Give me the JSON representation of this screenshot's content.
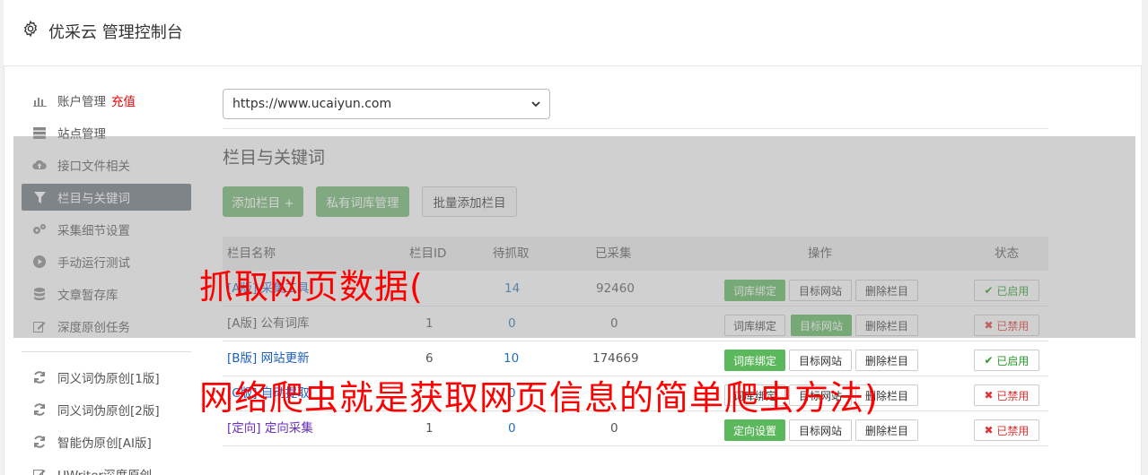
{
  "header": {
    "title": "优采云 管理控制台"
  },
  "sidebar": {
    "items": [
      {
        "label": "账户管理",
        "extra": "充值",
        "icon": "bar-chart-icon"
      },
      {
        "label": "站点管理",
        "icon": "server-icon"
      },
      {
        "label": "接口文件相关",
        "icon": "cloud-upload-icon"
      },
      {
        "label": "栏目与关键词",
        "icon": "filter-icon",
        "active": true
      },
      {
        "label": "采集细节设置",
        "icon": "cogs-icon"
      },
      {
        "label": "手动运行测试",
        "icon": "play-circle-icon"
      },
      {
        "label": "文章暂存库",
        "icon": "database-icon"
      },
      {
        "label": "深度原创任务",
        "icon": "edit-icon"
      }
    ],
    "items2": [
      {
        "label": "同义词伪原创[1版]",
        "icon": "refresh-icon"
      },
      {
        "label": "同义词伪原创[2版]",
        "icon": "refresh-icon"
      },
      {
        "label": "智能伪原创[AI版]",
        "icon": "refresh-icon"
      },
      {
        "label": "UWriter深度原创",
        "icon": "edit-icon"
      }
    ]
  },
  "site_select": {
    "value": "https://www.ucaiyun.com"
  },
  "main": {
    "section_title": "栏目与关键词",
    "buttons": {
      "add": "添加栏目 +",
      "private_lib": "私有词库管理",
      "batch_add": "批量添加栏目"
    }
  },
  "table": {
    "headers": [
      "栏目名称",
      "栏目ID",
      "待抓取",
      "已采集",
      "操作",
      "状态"
    ],
    "rows": [
      {
        "name": "[A版] 采集工具",
        "id": "",
        "pending": "14",
        "collected": "92460",
        "op1": "词库绑定",
        "op2": "目标网站",
        "op3": "删除栏目",
        "status": "已启用"
      },
      {
        "name": "[A版] 公有词库",
        "id": "1",
        "pending": "0",
        "collected": "0",
        "op1": "词库绑定",
        "op2": "目标网站",
        "op3": "删除栏目",
        "status": "已禁用"
      },
      {
        "name": "[B版] 网站更新",
        "id": "6",
        "pending": "10",
        "collected": "174669",
        "op1": "词库绑定",
        "op2": "目标网站",
        "op3": "删除栏目",
        "status": "已启用"
      },
      {
        "name": "[C版] 自动提取",
        "id": "",
        "pending": "0",
        "collected": "",
        "op1": "词库绑定",
        "op2": "目标网站",
        "op3": "删除栏目",
        "status": "已禁用"
      },
      {
        "name": "[定向] 定向采集",
        "id": "1",
        "pending": "0",
        "collected": "0",
        "op1": "定向设置",
        "op2": "目标网站",
        "op3": "删除栏目",
        "status": "已禁用"
      }
    ]
  },
  "captions": {
    "line1": "抓取网页数据(",
    "line2": "网络爬虫就是获取网页信息的简单爬虫方法)"
  },
  "colors": {
    "accent_green": "#5cb85c",
    "active_sidebar": "#6c757d",
    "caption_red": "#ff0000"
  }
}
